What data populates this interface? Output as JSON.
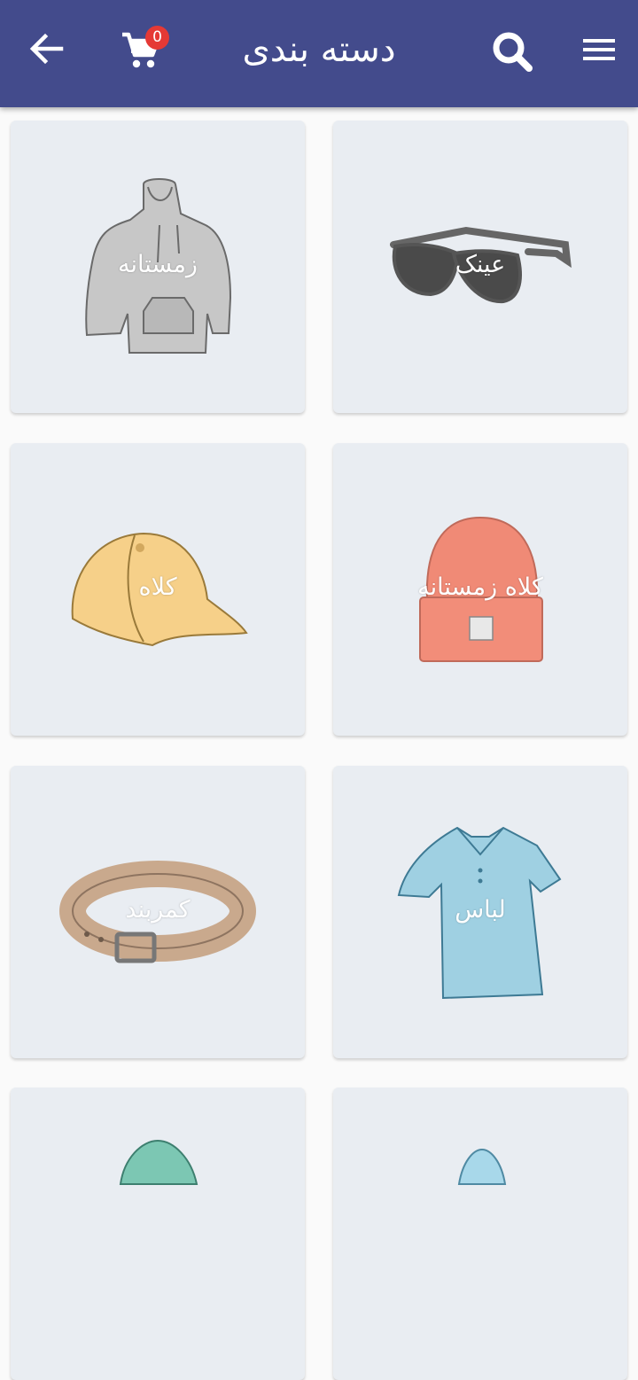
{
  "header": {
    "title": "دسته بندی",
    "cart_count": "0",
    "icons": [
      "back-arrow-icon",
      "cart-icon",
      "search-icon",
      "menu-icon"
    ],
    "color": "#434b8c"
  },
  "categories": [
    {
      "label": "زمستانه",
      "icon": "hoodie"
    },
    {
      "label": "عینک",
      "icon": "sunglasses"
    },
    {
      "label": "کلاه",
      "icon": "cap"
    },
    {
      "label": "کلاه زمستانه",
      "icon": "beanie"
    },
    {
      "label": "کمربند",
      "icon": "belt"
    },
    {
      "label": "لباس",
      "icon": "polo-shirt"
    },
    {
      "label": "",
      "icon": "bucket-hat"
    },
    {
      "label": "",
      "icon": "bucket-hat"
    }
  ]
}
